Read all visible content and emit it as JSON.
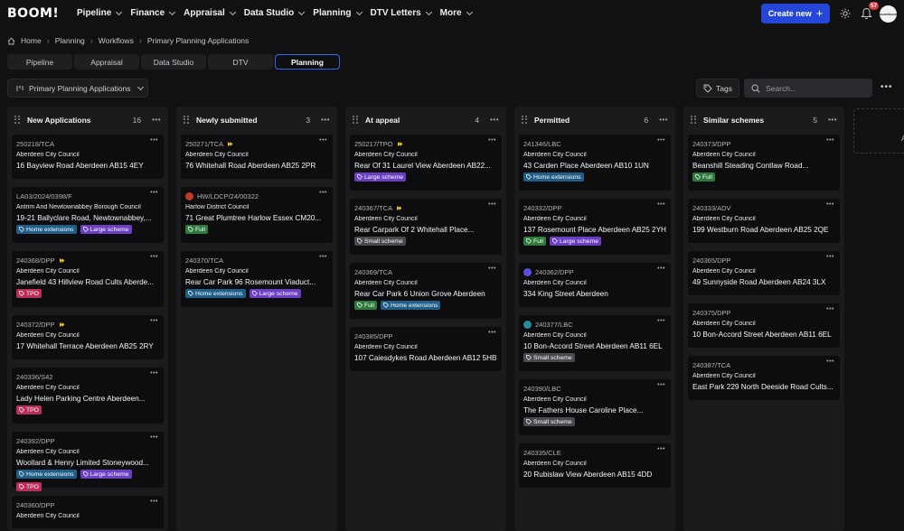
{
  "app": {
    "logo": "BOOM!"
  },
  "nav": {
    "items": [
      {
        "label": "Pipeline"
      },
      {
        "label": "Finance"
      },
      {
        "label": "Appraisal"
      },
      {
        "label": "Data Studio"
      },
      {
        "label": "Planning"
      },
      {
        "label": "DTV Letters"
      },
      {
        "label": "More"
      }
    ],
    "create_label": "Create new",
    "notifications": "57",
    "avatar_text": "boomboom"
  },
  "breadcrumb": [
    "Home",
    "Planning",
    "Workflows",
    "Primary Planning Applications"
  ],
  "view_tabs": [
    {
      "label": "Pipeline"
    },
    {
      "label": "Appraisal"
    },
    {
      "label": "Data Studio"
    },
    {
      "label": "DTV"
    },
    {
      "label": "Planning",
      "active": true
    }
  ],
  "toolbar": {
    "workflow_label": "Primary Planning Applications",
    "tags_label": "Tags",
    "search_placeholder": "Search..."
  },
  "colors": {
    "accent": "#2546d6",
    "home_ext": "#1f5e87",
    "large_scheme": "#6a3fc2",
    "tpo": "#b83059",
    "small_scheme": "#4a4a4e",
    "full": "#2f7a3e"
  },
  "columns": [
    {
      "title": "New Applications",
      "count": "16",
      "cards": [
        {
          "ref": "250218/TCA",
          "council": "Aberdeen City Council",
          "address": "16 Bayview Road Aberdeen AB15 4EY",
          "tags": []
        },
        {
          "ref": "LA03/2024/0398/F",
          "council": "Antrim And Newtownabbey Borough Council",
          "address": "19-21 Ballyclare Road, Newtownabbey,...",
          "tags": [
            "Home extensions",
            "Large scheme"
          ]
        },
        {
          "ref": "240368/DPP",
          "flag": true,
          "council": "Aberdeen City Council",
          "address": "Janefield 43 Hillview Road Cults Aberde...",
          "tags": [
            "TPO"
          ]
        },
        {
          "ref": "240372/DPP",
          "flag": true,
          "council": "Aberdeen City Council",
          "address": "17 Whitehall Terrace Aberdeen AB25 2RY",
          "tags": []
        },
        {
          "ref": "240336/S42",
          "council": "Aberdeen City Council",
          "address": "Lady Helen Parking Centre Aberdeen...",
          "tags": [
            "TPO"
          ]
        },
        {
          "ref": "240392/DPP",
          "council": "Aberdeen City Council",
          "address": "Woollard & Henry Limited Stoneywood...",
          "tags": [
            "Home extensions",
            "Large scheme",
            "TPO"
          ]
        },
        {
          "ref": "240360/DPP",
          "council": "Aberdeen City Council",
          "address": "",
          "tags": []
        }
      ]
    },
    {
      "title": "Newly submitted",
      "count": "3",
      "cards": [
        {
          "ref": "250271/TCA",
          "flag": true,
          "council": "Aberdeen City Council",
          "address": "76 Whitehall Road Aberdeen AB25 2PR",
          "tags": []
        },
        {
          "ref": "HW/LDCP/24/00322",
          "dot": "#c0392b",
          "council": "Harlow District Council",
          "address": "71 Great Plumtree Harlow Essex CM20...",
          "tags": [
            "Full"
          ]
        },
        {
          "ref": "240370/TCA",
          "council": "Aberdeen City Council",
          "address": "Rear Car Park 96 Rosemount Viaduct...",
          "tags": [
            "Home extensions",
            "Large scheme"
          ]
        }
      ]
    },
    {
      "title": "At appeal",
      "count": "4",
      "cards": [
        {
          "ref": "250217/TPO",
          "flag": true,
          "council": "Aberdeen City Council",
          "address": "Rear Of 31 Laurel View Aberdeen AB22...",
          "tags": [
            "Large scheme"
          ]
        },
        {
          "ref": "240367/TCA",
          "flag": true,
          "council": "Aberdeen City Council",
          "address": "Rear Carpark Of 2 Whitehall Place...",
          "tags": [
            "Small scheme"
          ]
        },
        {
          "ref": "240369/TCA",
          "council": "Aberdeen City Council",
          "address": "Rear Car Park 6 Union Grove Aberdeen",
          "tags": [
            "Full",
            "Home extensions"
          ]
        },
        {
          "ref": "240385/DPP",
          "council": "Aberdeen City Council",
          "address": "107 Caiesdykes Road Aberdeen AB12 5HB",
          "tags": []
        }
      ]
    },
    {
      "title": "Permitted",
      "count": "6",
      "cards": [
        {
          "ref": "241346/LBC",
          "council": "Aberdeen City Council",
          "address": "43 Carden Place Aberdeen AB10 1UN",
          "tags": [
            "Home extensions"
          ]
        },
        {
          "ref": "240332/DPP",
          "council": "Aberdeen City Council",
          "address": "137 Rosemount Place Aberdeen AB25 2YH",
          "tags": [
            "Full",
            "Large scheme"
          ]
        },
        {
          "ref": "240362/DPP",
          "dot": "#5b4fd6",
          "council": "Aberdeen City Council",
          "address": "334 King Street Aberdeen",
          "tags": []
        },
        {
          "ref": "240377/LBC",
          "dot": "#2b8a9a",
          "council": "Aberdeen City Council",
          "address": "10 Bon-Accord Street Aberdeen AB11 6EL",
          "tags": [
            "Small scheme"
          ]
        },
        {
          "ref": "240390/LBC",
          "council": "Aberdeen City Council",
          "address": "The Fathers House Caroline Place...",
          "tags": [
            "Small scheme"
          ]
        },
        {
          "ref": "240335/CLE",
          "council": "Aberdeen City Council",
          "address": "20 Rubislaw View Aberdeen AB15 4DD",
          "tags": []
        }
      ]
    },
    {
      "title": "Similar schemes",
      "count": "5",
      "cards": [
        {
          "ref": "240373/DPP",
          "council": "Aberdeen City Council",
          "address": "Beanshill Steading Contlaw Road...",
          "tags": [
            "Full"
          ]
        },
        {
          "ref": "240333/ADV",
          "council": "Aberdeen City Council",
          "address": "199 Westburn Road Aberdeen AB25 2QE",
          "tags": []
        },
        {
          "ref": "240365/DPP",
          "council": "Aberdeen City Council",
          "address": "49 Sunnyside Road Aberdeen AB24 3LX",
          "tags": []
        },
        {
          "ref": "240375/DPP",
          "council": "Aberdeen City Council",
          "address": "10 Bon-Accord Street Aberdeen AB11 6EL",
          "tags": []
        },
        {
          "ref": "240387/TCA",
          "council": "Aberdeen City Council",
          "address": "East Park 229 North Deeside Road Cults...",
          "tags": []
        }
      ]
    }
  ]
}
